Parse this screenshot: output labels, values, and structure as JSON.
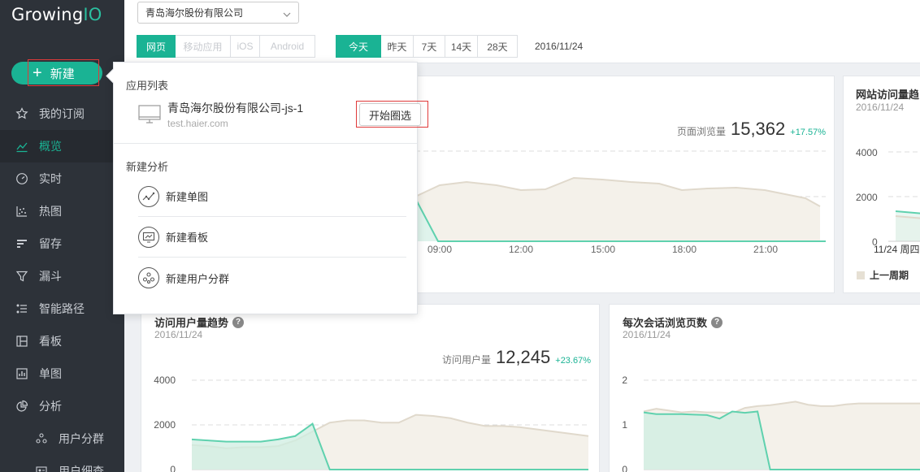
{
  "logo": {
    "text_main": "Growing",
    "text_accent": "IO"
  },
  "sidebar": {
    "new_button": "新建",
    "items": [
      {
        "label": "我的订阅",
        "icon": "star-icon"
      },
      {
        "label": "概览",
        "icon": "trend-icon",
        "active": true
      },
      {
        "label": "实时",
        "icon": "realtime-icon"
      },
      {
        "label": "热图",
        "icon": "heatmap-icon"
      },
      {
        "label": "留存",
        "icon": "retention-icon"
      },
      {
        "label": "漏斗",
        "icon": "funnel-icon"
      },
      {
        "label": "智能路径",
        "icon": "path-icon"
      },
      {
        "label": "看板",
        "icon": "dashboard-icon"
      },
      {
        "label": "单图",
        "icon": "chart-icon"
      },
      {
        "label": "分析",
        "icon": "pie-icon"
      },
      {
        "label": "用户分群",
        "icon": "segment-icon"
      },
      {
        "label": "用户细查",
        "icon": "user-detail-icon"
      }
    ]
  },
  "topbar": {
    "company": "青岛海尔股份有限公司"
  },
  "filters": {
    "platforms": [
      "网页",
      "移动应用",
      "iOS",
      "Android"
    ],
    "ranges": [
      "今天",
      "昨天",
      "7天",
      "14天",
      "28天"
    ],
    "date": "2016/11/24"
  },
  "popup": {
    "app_list_title": "应用列表",
    "app_name": "青岛海尔股份有限公司-js-1",
    "app_host": "test.haier.com",
    "start_button": "开始圈选",
    "new_analysis_title": "新建分析",
    "new_items": [
      "新建单图",
      "新建看板",
      "新建用户分群"
    ]
  },
  "colors": {
    "accent": "#1ab394",
    "sidebar_bg": "#2d3239",
    "highlight": "#e03a3a",
    "prev_series": "#e6e0d4"
  },
  "cards": {
    "pageviews": {
      "kpi_label": "页面浏览量",
      "kpi_value": "15,362",
      "kpi_change": "+17.57%"
    },
    "site_visits": {
      "title": "网站访问量趋",
      "date": "2016/11/24",
      "legend_prev": "上一周期"
    },
    "users": {
      "title": "访问用户量趋势",
      "date": "2016/11/24",
      "kpi_label": "访问用户量",
      "kpi_value": "12,245",
      "kpi_change": "+23.67%"
    },
    "session_pages": {
      "title": "每次会话浏览页数",
      "date": "2016/11/24"
    }
  },
  "chart_data": [
    {
      "type": "area",
      "x_ticks": [
        "09:00",
        "12:00",
        "15:00",
        "18:00",
        "21:00"
      ],
      "grid": true
    },
    {
      "type": "area",
      "y_ticks": [
        "4000",
        "2000",
        "0"
      ],
      "x_ticks": [
        "11/24 周四"
      ],
      "legend": [
        "上一周期"
      ]
    },
    {
      "type": "area",
      "y_ticks": [
        "4000",
        "2000",
        "0"
      ],
      "ylim": [
        0,
        4000
      ],
      "series": [
        {
          "values": [
            1350,
            1300,
            1250,
            1250,
            1250,
            1350,
            1500,
            2050,
            0,
            0,
            0,
            0,
            0,
            0,
            0,
            0,
            0,
            0,
            0,
            0,
            0,
            0,
            0,
            0
          ]
        },
        {
          "name": "上一周期",
          "values": [
            1100,
            1050,
            950,
            1000,
            1000,
            1050,
            1300,
            1700,
            2100,
            2200,
            2200,
            2100,
            2100,
            2450,
            2400,
            2300,
            2100,
            1950,
            1950,
            1900,
            1800,
            1700,
            1600,
            1500
          ]
        }
      ]
    },
    {
      "type": "area",
      "y_ticks": [
        "2",
        "1",
        "0"
      ],
      "ylim": [
        0,
        2
      ],
      "series": [
        {
          "values": [
            1.28,
            1.24,
            1.24,
            1.24,
            1.23,
            1.22,
            1.14,
            1.3,
            1.27,
            1.3,
            0,
            0,
            0,
            0,
            0,
            0,
            0,
            0,
            0,
            0,
            0,
            0,
            0,
            0
          ]
        },
        {
          "name": "上一周期",
          "values": [
            1.3,
            1.36,
            1.32,
            1.28,
            1.3,
            1.28,
            1.28,
            1.26,
            1.38,
            1.42,
            1.44,
            1.48,
            1.52,
            1.45,
            1.42,
            1.42,
            1.46,
            1.48,
            1.48,
            1.48,
            1.48,
            1.48,
            1.48,
            1.48
          ]
        }
      ]
    }
  ]
}
